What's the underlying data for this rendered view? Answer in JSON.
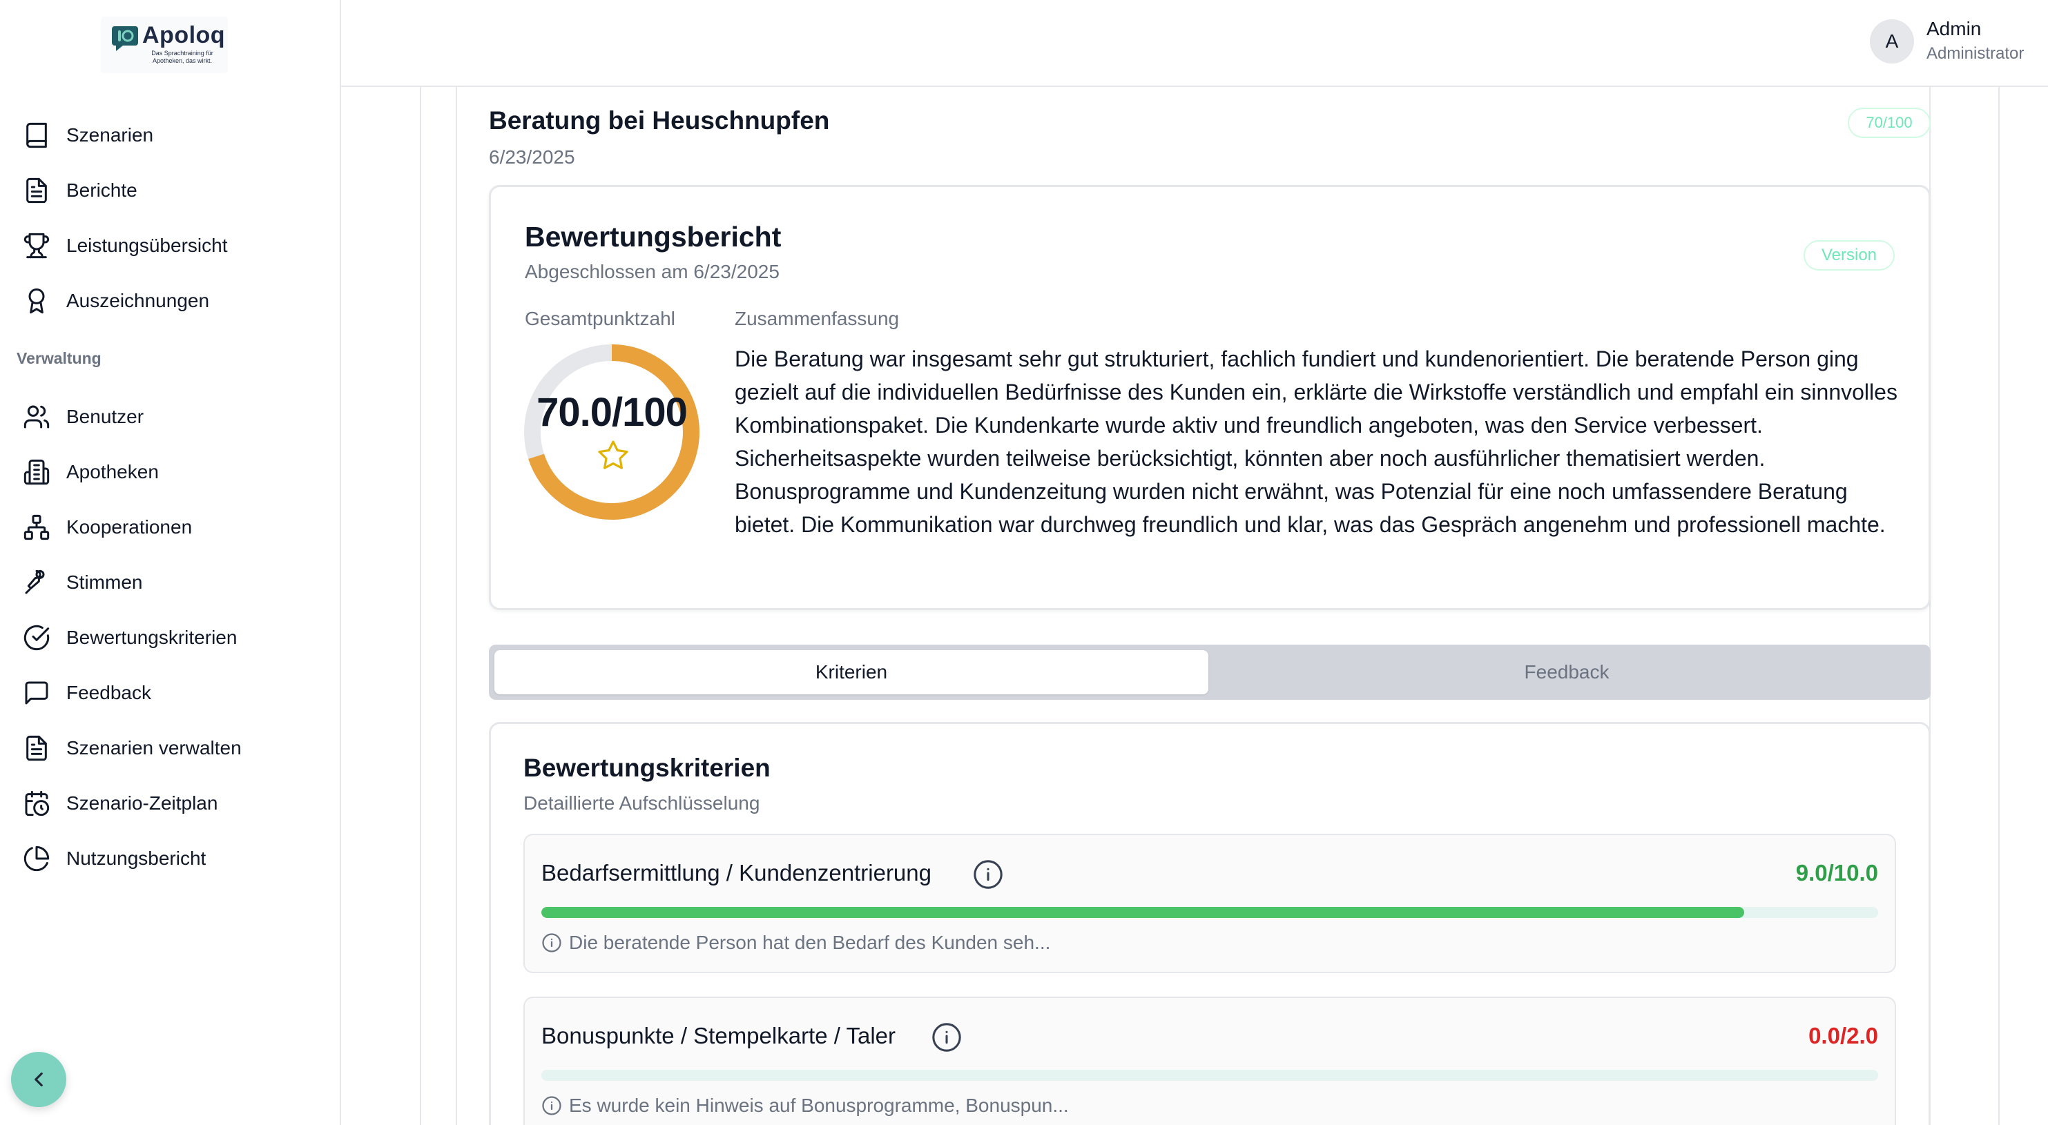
{
  "brand": {
    "name": "Apoloq",
    "tagline": "Das Sprachtraining für Apotheken, das wirkt."
  },
  "sidebar": {
    "items": [
      {
        "label": "Szenarien",
        "icon": "book-icon"
      },
      {
        "label": "Berichte",
        "icon": "document-icon"
      },
      {
        "label": "Leistungsübersicht",
        "icon": "trophy-icon"
      },
      {
        "label": "Auszeichnungen",
        "icon": "award-icon"
      }
    ],
    "section_label": "Verwaltung",
    "admin_items": [
      {
        "label": "Benutzer",
        "icon": "users-icon"
      },
      {
        "label": "Apotheken",
        "icon": "building-icon"
      },
      {
        "label": "Kooperationen",
        "icon": "network-icon"
      },
      {
        "label": "Stimmen",
        "icon": "microphone-icon"
      },
      {
        "label": "Bewertungskriterien",
        "icon": "check-circle-icon"
      },
      {
        "label": "Feedback",
        "icon": "message-icon"
      },
      {
        "label": "Szenarien verwalten",
        "icon": "document-icon"
      },
      {
        "label": "Szenario-Zeitplan",
        "icon": "calendar-clock-icon"
      },
      {
        "label": "Nutzungsbericht",
        "icon": "pie-chart-icon"
      }
    ]
  },
  "header": {
    "avatar_initial": "A",
    "user_name": "Admin",
    "user_role": "Administrator"
  },
  "page": {
    "title": "Beratung bei Heuschnupfen",
    "date": "6/23/2025",
    "score_badge": "70/100"
  },
  "report": {
    "title": "Bewertungsbericht",
    "subtitle": "Abgeschlossen am 6/23/2025",
    "version_badge": "Version",
    "total_label": "Gesamtpunktzahl",
    "total_value": "70.0/100",
    "total_fraction": 0.7,
    "summary_label": "Zusammenfassung",
    "summary": "Die Beratung war insgesamt sehr gut strukturiert, fachlich fundiert und kundenorientiert. Die beratende Person ging gezielt auf die individuellen Bedürfnisse des Kunden ein, erklärte die Wirkstoffe verständlich und empfahl ein sinnvolles Kombinationspaket. Die Kundenkarte wurde aktiv und freundlich angeboten, was den Service verbessert. Sicherheitsaspekte wurden teilweise berücksichtigt, könnten aber noch ausführlicher thematisiert werden. Bonusprogramme und Kundenzeitung wurden nicht erwähnt, was Potenzial für eine noch umfassendere Beratung bietet. Die Kommunikation war durchweg freundlich und klar, was das Gespräch angenehm und professionell machte."
  },
  "tabs": {
    "criteria": "Kriterien",
    "feedback": "Feedback"
  },
  "criteria": {
    "title": "Bewertungskriterien",
    "subtitle": "Detaillierte Aufschlüsselung",
    "items": [
      {
        "name": "Bedarfsermittlung / Kundenzentrierung",
        "score": "9.0/10.0",
        "fraction": 0.9,
        "note": "Die beratende Person hat den Bedarf des Kunden seh...",
        "score_color": "#2e9e48"
      },
      {
        "name": "Bonuspunkte / Stempelkarte / Taler",
        "score": "0.0/2.0",
        "fraction": 0.0,
        "note": "Es wurde kein Hinweis auf Bonusprogramme, Bonuspun...",
        "score_color": "#dc2626"
      }
    ]
  },
  "colors": {
    "accent": "#7dd3c0",
    "gauge": "#e9a23b",
    "gauge_track": "#e5e7eb",
    "progress_fill": "#4ac266"
  }
}
